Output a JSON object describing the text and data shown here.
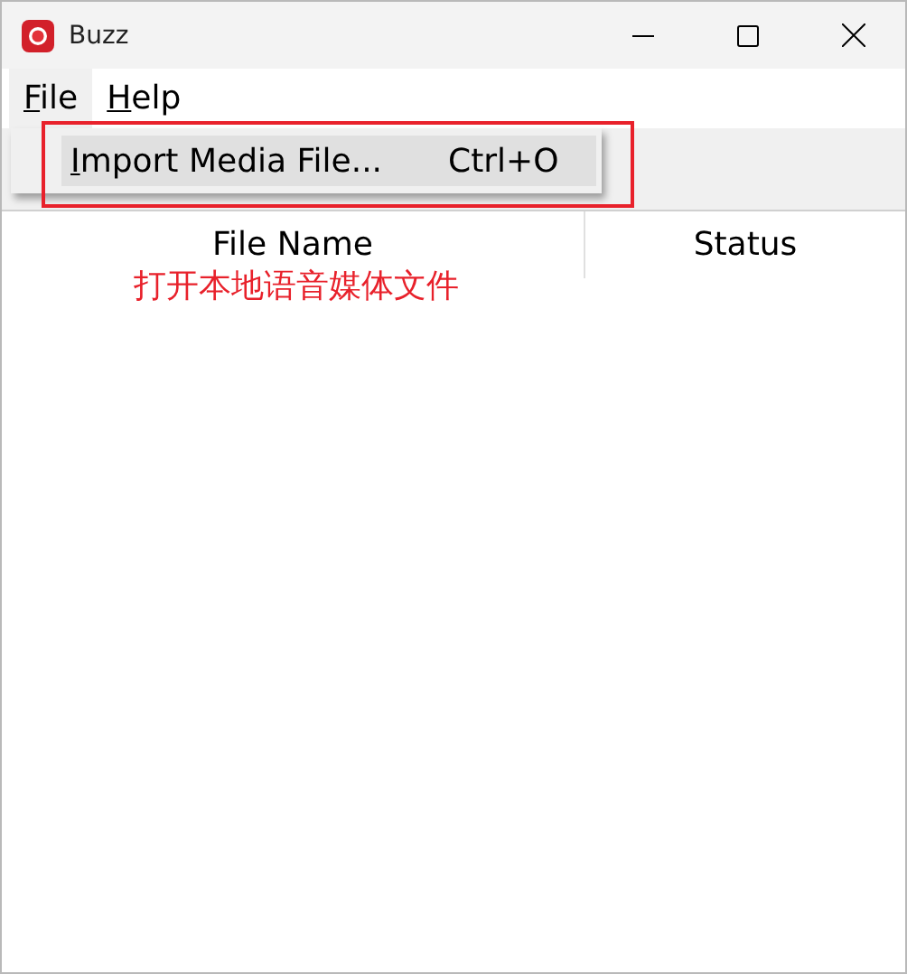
{
  "window": {
    "title": "Buzz"
  },
  "menu_bar": [
    {
      "label": "File",
      "mnemonic_underlined": true,
      "selected": true
    },
    {
      "label": "Help",
      "mnemonic_underlined": true,
      "selected": false
    }
  ],
  "open_menu": {
    "items": [
      {
        "label": "Import Media File...",
        "shortcut": "Ctrl+O",
        "mnemonic_underlined": true,
        "selected": true
      }
    ]
  },
  "table": {
    "columns": [
      "File Name",
      "Status"
    ]
  },
  "annotation": {
    "text": "打开本地语音媒体文件",
    "color": "#e8212b"
  }
}
